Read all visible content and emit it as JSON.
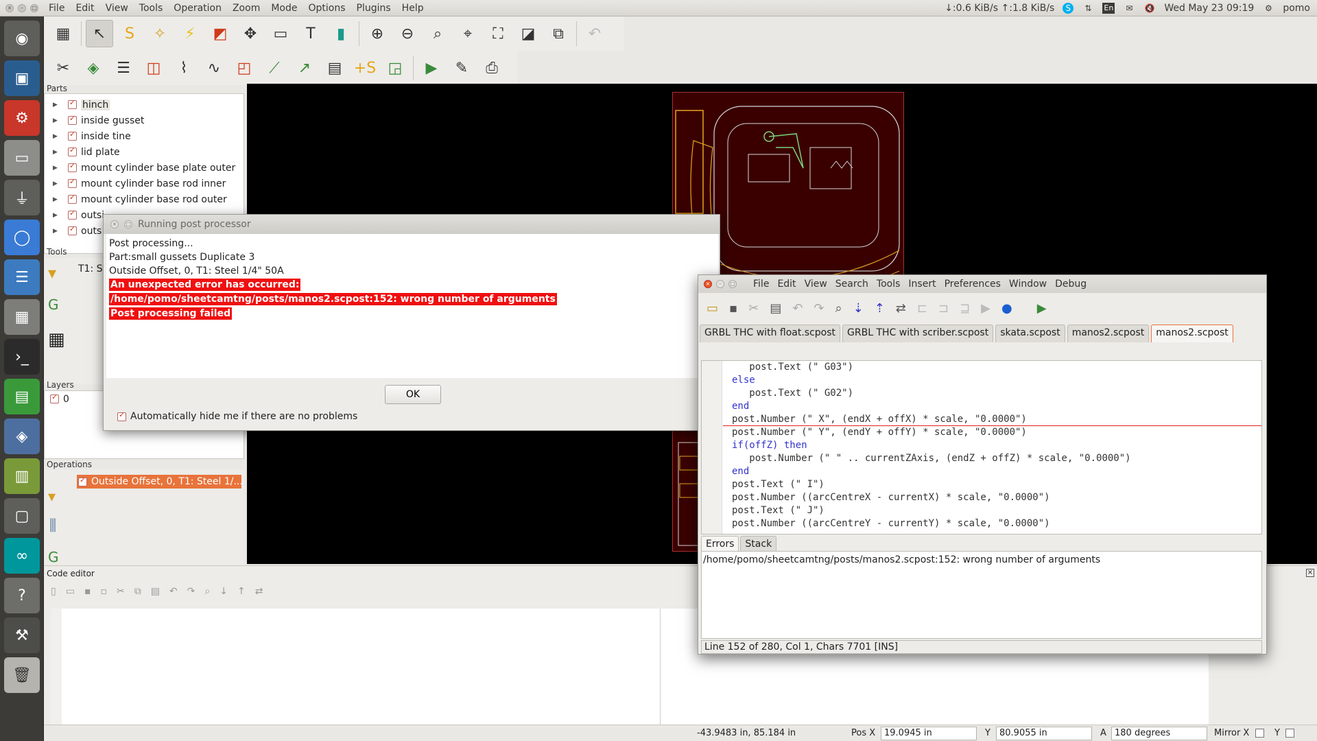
{
  "topbar": {
    "menu": [
      "File",
      "Edit",
      "View",
      "Tools",
      "Operation",
      "Zoom",
      "Mode",
      "Options",
      "Plugins",
      "Help"
    ],
    "net_speed": "↓:0.6 KiB/s ↑:1.8 KiB/s",
    "keyboard": "En",
    "clock": "Wed May 23 09:19",
    "user": "pomo"
  },
  "panels": {
    "parts_label": "Parts",
    "tools_label": "Tools",
    "layers_label": "Layers",
    "operations_label": "Operations",
    "code_editor_label": "Code editor"
  },
  "parts": [
    {
      "label": "hinch",
      "selected": true
    },
    {
      "label": "inside gusset"
    },
    {
      "label": "inside tine"
    },
    {
      "label": "lid plate"
    },
    {
      "label": "mount cylinder base plate outer"
    },
    {
      "label": "mount cylinder base rod inner"
    },
    {
      "label": "mount cylinder base rod outer"
    },
    {
      "label": "outsi"
    },
    {
      "label": "outs"
    }
  ],
  "tools": {
    "first": "T1: St"
  },
  "layers": [
    {
      "label": "0"
    }
  ],
  "operations": [
    {
      "label": "Outside Offset, 0, T1: Steel 1/..."
    }
  ],
  "post_dialog": {
    "title": "Running post processor",
    "lines": [
      "Post processing...",
      "Part:small gussets Duplicate 3",
      "Outside Offset, 0, T1: Steel 1/4\" 50A"
    ],
    "errors": [
      "An unexpected error has occurred:",
      "/home/pomo/sheetcamtng/posts/manos2.scpost:152: wrong number of arguments",
      "Post processing failed"
    ],
    "ok_label": "OK",
    "auto_hide_label": "Automatically hide me if there are no problems"
  },
  "script_editor": {
    "menu": [
      "File",
      "Edit",
      "View",
      "Search",
      "Tools",
      "Insert",
      "Preferences",
      "Window",
      "Debug"
    ],
    "tabs": [
      "GRBL THC with float.scpost",
      "GRBL THC with scriber.scpost",
      "skata.scpost",
      "manos2.scpost",
      "manos2.scpost"
    ],
    "code": [
      "   post.Text (\" G03\")",
      "else",
      "   post.Text (\" G02\")",
      "end",
      "post.Number (\" X\", (endX + offX) * scale, \"0.0000\")",
      "post.Number (\" Y\", (endY + offY) * scale, \"0.0000\")",
      "if(offZ) then",
      "   post.Number (\" \" .. currentZAxis, (endZ + offZ) * scale, \"0.0000\")",
      "end",
      "post.Text (\" I\")",
      "post.Number ((arcCentreX - currentX) * scale, \"0.0000\")",
      "post.Text (\" J\")",
      "post.Number ((arcCentreY - currentY) * scale, \"0.0000\")"
    ],
    "err_tabs": [
      "Errors",
      "Stack"
    ],
    "error_text": "/home/pomo/sheetcamtng/posts/manos2.scpost:152: wrong number of arguments",
    "status": "Line   152 of    280, Col    1, Chars  7701  [INS]"
  },
  "statusbar": {
    "coords": "-43.9483 in, 85.184 in",
    "pos_x_label": "Pos X",
    "pos_x": "19.0945 in",
    "y_label": "Y",
    "y": "80.9055 in",
    "a_label": "A",
    "a": "180 degrees",
    "mirror_x_label": "Mirror X",
    "mirror_y_label": "Y"
  },
  "colors": {
    "accent": "#e8733b",
    "error_bg": "#f01010",
    "sheet": "#3a0000"
  }
}
